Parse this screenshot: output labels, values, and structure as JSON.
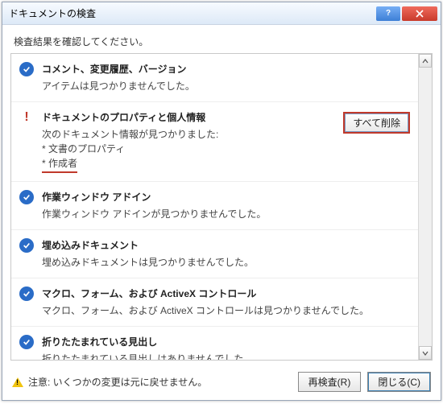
{
  "window": {
    "title": "ドキュメントの検査"
  },
  "instruction": "検査結果を確認してください。",
  "items": [
    {
      "status": "ok",
      "heading": "コメント、変更履歴、バージョン",
      "body": "アイテムは見つかりませんでした。"
    },
    {
      "status": "warn",
      "heading": "ドキュメントのプロパティと個人情報",
      "body_line1": "次のドキュメント情報が見つかりました:",
      "body_line2": "* 文書のプロパティ",
      "body_line3": "* 作成者",
      "button": "すべて削除"
    },
    {
      "status": "ok",
      "heading": "作業ウィンドウ アドイン",
      "body": "作業ウィンドウ アドインが見つかりませんでした。"
    },
    {
      "status": "ok",
      "heading": "埋め込みドキュメント",
      "body": "埋め込みドキュメントは見つかりませんでした。"
    },
    {
      "status": "ok",
      "heading": "マクロ、フォーム、および ActiveX コントロール",
      "body": "マクロ、フォーム、および ActiveX コントロールは見つかりませんでした。"
    },
    {
      "status": "ok",
      "heading": "折りたたまれている見出し",
      "body": "折りたたまれている見出しはありませんでした。"
    }
  ],
  "footer": {
    "note": "注意: いくつかの変更は元に戻せません。",
    "reinspect": "再検査(R)",
    "close": "閉じる(C)"
  }
}
